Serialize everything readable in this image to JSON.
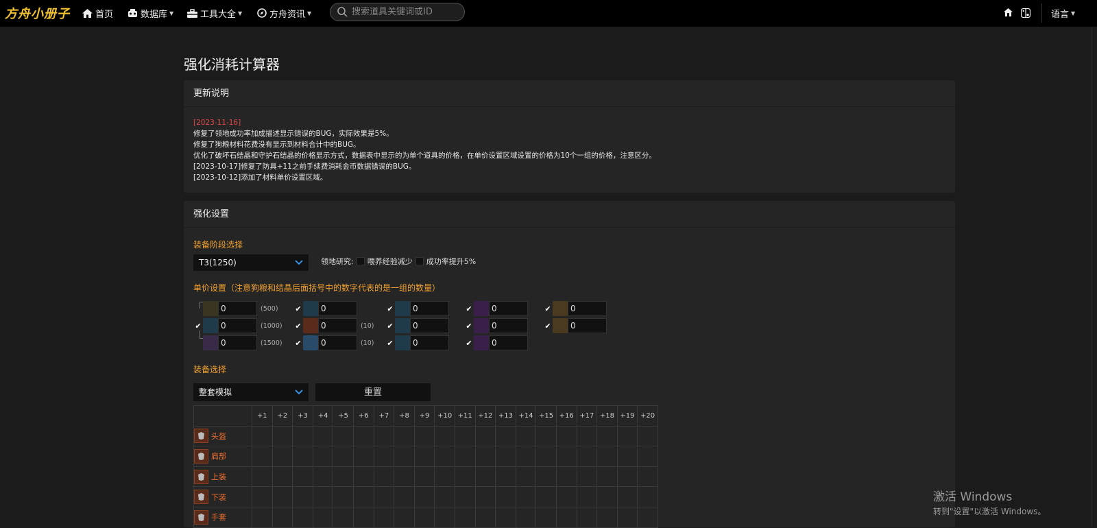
{
  "nav": {
    "logo": "方舟小册子",
    "home": "首页",
    "database": "数据库",
    "tools": "工具大全",
    "news": "方舟资讯",
    "search_placeholder": "搜索道具关键词或ID",
    "language": "语言"
  },
  "page_title": "强化消耗计算器",
  "updates": {
    "title": "更新说明",
    "date": "[2023-11-16]",
    "lines": [
      "修复了领地成功率加成描述显示错误的BUG，实际效果是5%。",
      "修复了狗粮材料花费没有显示到材料合计中的BUG。",
      "优化了破坏石结晶和守护石结晶的价格显示方式，数据表中显示的为单个道具的价格，在单价设置区域设置的价格为10个一组的价格，注意区分。",
      "[2023-10-17]修复了防具+11之前手续费消耗金币数据错误的BUG。",
      "[2023-10-12]添加了材料单价设置区域。"
    ]
  },
  "settings": {
    "title": "强化设置",
    "stage_label": "装备阶段选择",
    "stage_value": "T3(1250)",
    "research_label": "领地研究:",
    "opt_exp": "喂养经验减少",
    "opt_rate": "成功率提升5%",
    "price_label": "单价设置（注意狗粮和结晶后面括号中的数字代表的是一组的数量）",
    "price_cells": [
      {
        "value": "0",
        "qty": "(500)"
      },
      {
        "value": "0",
        "qty": "(1000)"
      },
      {
        "value": "0",
        "qty": "(1500)"
      },
      {
        "value": "0",
        "qty": ""
      },
      {
        "value": "0",
        "qty": "(10)"
      },
      {
        "value": "0",
        "qty": "(10)"
      },
      {
        "value": "0",
        "qty": ""
      },
      {
        "value": "0",
        "qty": ""
      },
      {
        "value": "0",
        "qty": ""
      },
      {
        "value": "0",
        "qty": ""
      },
      {
        "value": "0",
        "qty": ""
      },
      {
        "value": "0",
        "qty": ""
      },
      {
        "value": "0",
        "qty": ""
      },
      {
        "value": "0",
        "qty": ""
      }
    ],
    "equip_label": "装备选择",
    "equip_value": "整套模拟",
    "reset": "重置",
    "levels": [
      "+1",
      "+2",
      "+3",
      "+4",
      "+5",
      "+6",
      "+7",
      "+8",
      "+9",
      "+10",
      "+11",
      "+12",
      "+13",
      "+14",
      "+15",
      "+16",
      "+17",
      "+18",
      "+19",
      "+20"
    ],
    "equipment": [
      "头盔",
      "肩部",
      "上装",
      "下装",
      "手套"
    ]
  },
  "watermark": {
    "line1": "激活 Windows",
    "line2": "转到\"设置\"以激活 Windows。"
  },
  "colors": {
    "accent_orange": "#f0a030",
    "date_red": "#e04848",
    "logo_yellow": "#f2c230",
    "equip_orange": "#f07030"
  }
}
